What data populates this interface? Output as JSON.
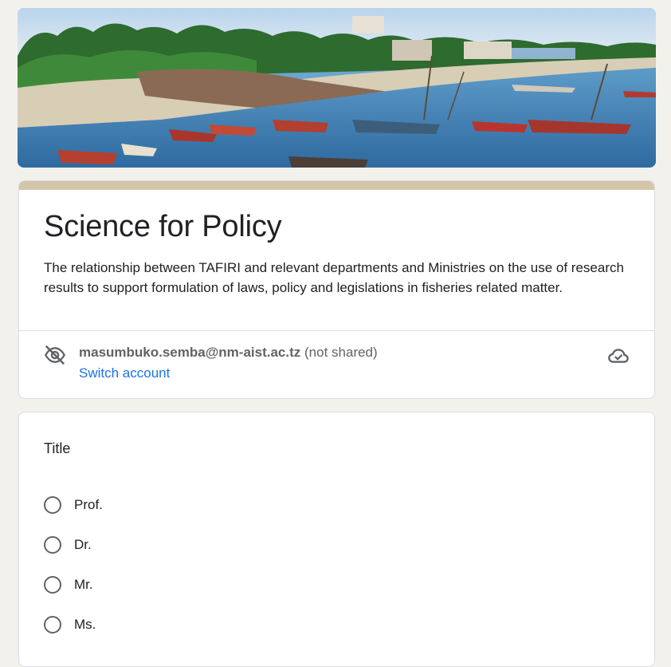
{
  "banner": {
    "image_name": "fishing-harbor-photo"
  },
  "header": {
    "accent_color": "#d3c6ab",
    "title": "Science for Policy",
    "description": "The relationship between TAFIRI and relevant departments and Ministries on the use of research results to support formulation of laws, policy and legislations in fisheries related matter."
  },
  "account": {
    "email": "masumbuko.semba@nm-aist.ac.tz",
    "shared_status": "(not shared)",
    "switch_label": "Switch account",
    "icons": {
      "privacy": "eye-off-icon",
      "save_status": "cloud-done-icon"
    }
  },
  "question": {
    "title": "Title",
    "options": [
      "Prof.",
      "Dr.",
      "Mr.",
      "Ms."
    ]
  },
  "colors": {
    "link": "#1a73e8",
    "background": "#f3f1ec"
  }
}
